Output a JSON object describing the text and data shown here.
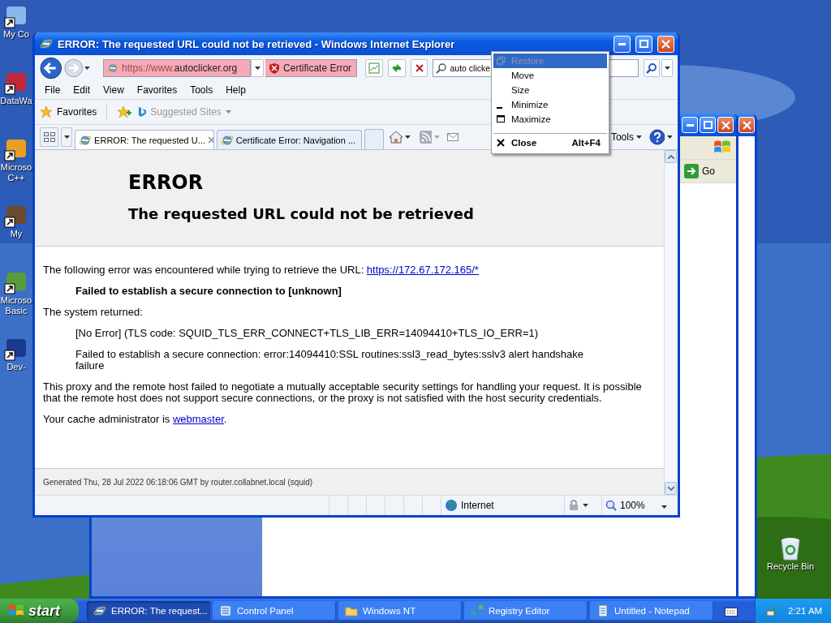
{
  "desktop_icons": [
    {
      "label": "My Co"
    },
    {
      "label": "DataWa"
    },
    {
      "label": "Microso",
      "label_2": "C++"
    },
    {
      "label": "My"
    },
    {
      "label": "Microso",
      "label_2": "Basic"
    },
    {
      "label": "Dev-"
    }
  ],
  "recycle_bin": {
    "label": "Recycle Bin"
  },
  "explorer_window": {
    "go_button": "Go"
  },
  "browser": {
    "title": "ERROR: The requested URL could not be retrieved - Windows Internet Explorer",
    "address": {
      "prefix": "https://www.",
      "domain": "autoclicker.org"
    },
    "certificate_error": "Certificate Error",
    "search": {
      "value": "auto clicke"
    },
    "menu": [
      "File",
      "Edit",
      "View",
      "Favorites",
      "Tools",
      "Help"
    ],
    "favorites": "Favorites",
    "suggested_sites": "Suggested Sites",
    "tabs": [
      {
        "label": "ERROR: The requested U...",
        "selected": true
      },
      {
        "label": "Certificate Error: Navigation ...",
        "selected": false
      }
    ],
    "tools": "Tools",
    "page": {
      "heading": "ERROR",
      "subheading": "The requested URL could not be retrieved",
      "intro": {
        "text": "The following error was encountered while trying to retrieve the URL: ",
        "link": "https://172.67.172.165/*"
      },
      "failure": "Failed to establish a secure connection to [unknown]",
      "system_returned": "The system returned:",
      "details": [
        "[No Error] (TLS code: SQUID_TLS_ERR_CONNECT+TLS_LIB_ERR=14094410+TLS_IO_ERR=1)",
        "Failed to establish a secure connection: error:14094410:SSL routines:ssl3_read_bytes:sslv3 alert handshake failure"
      ],
      "explanation": "This proxy and the remote host failed to negotiate a mutually acceptable security settings for handling your request. It is possible that the remote host does not support secure connections, or the proxy is not satisfied with the host security credentials.",
      "admin": {
        "text": "Your cache administrator is ",
        "link": "webmaster",
        "after": "."
      },
      "footer": "Generated Thu, 28 Jul 2022 06:18:06 GMT by router.collabnet.local (squid)"
    },
    "status": {
      "zone": "Internet",
      "zoom": "100%"
    }
  },
  "context_menu": {
    "items": [
      {
        "label": "Restore",
        "disabled": true,
        "selected": true,
        "default": false,
        "separator_before": false
      },
      {
        "label": "Move",
        "disabled": false,
        "selected": false,
        "default": false,
        "separator_before": false
      },
      {
        "label": "Size",
        "disabled": false,
        "selected": false,
        "default": false,
        "separator_before": false
      },
      {
        "label": "Minimize",
        "disabled": false,
        "selected": false,
        "default": false,
        "separator_before": false
      },
      {
        "label": "Maximize",
        "disabled": false,
        "selected": false,
        "default": false,
        "separator_before": false
      },
      {
        "label": "Close",
        "shortcut": "Alt+F4",
        "disabled": false,
        "selected": false,
        "default": true,
        "separator_before": true
      }
    ]
  },
  "taskbar": {
    "start": "start",
    "buttons": [
      {
        "label": "ERROR: The request...",
        "selected": true
      },
      {
        "label": "Control Panel",
        "selected": false
      },
      {
        "label": "Windows NT",
        "selected": false
      },
      {
        "label": "Registry Editor",
        "selected": false
      },
      {
        "label": "Untitled - Notepad",
        "selected": false
      }
    ],
    "clock": "2:21 AM"
  }
}
